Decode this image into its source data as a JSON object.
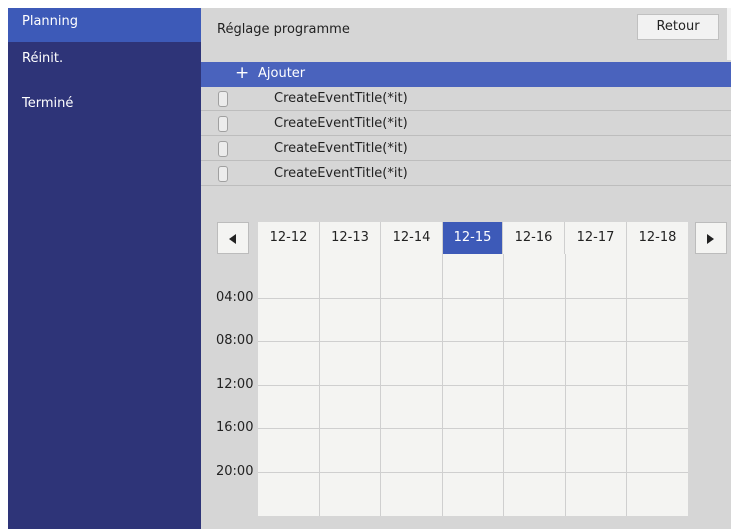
{
  "sidebar": {
    "items": [
      {
        "label": "Planning",
        "active": true
      },
      {
        "label": "Réinit.",
        "active": false
      },
      {
        "label": "Terminé",
        "active": false
      }
    ]
  },
  "header": {
    "title": "Réglage programme",
    "back_label": "Retour"
  },
  "list": {
    "add_label": "Ajouter",
    "events": [
      {
        "title": "CreateEventTitle(*it)"
      },
      {
        "title": "CreateEventTitle(*it)"
      },
      {
        "title": "CreateEventTitle(*it)"
      },
      {
        "title": "CreateEventTitle(*it)"
      }
    ]
  },
  "calendar": {
    "dates": [
      "12-12",
      "12-13",
      "12-14",
      "12-15",
      "12-16",
      "12-17",
      "12-18"
    ],
    "selected_date": "12-15",
    "times": [
      "04:00",
      "08:00",
      "12:00",
      "16:00",
      "20:00"
    ]
  },
  "colors": {
    "sidebar_bg": "#2e3478",
    "accent": "#3d5ab8",
    "main_bg": "#d6d6d6"
  }
}
